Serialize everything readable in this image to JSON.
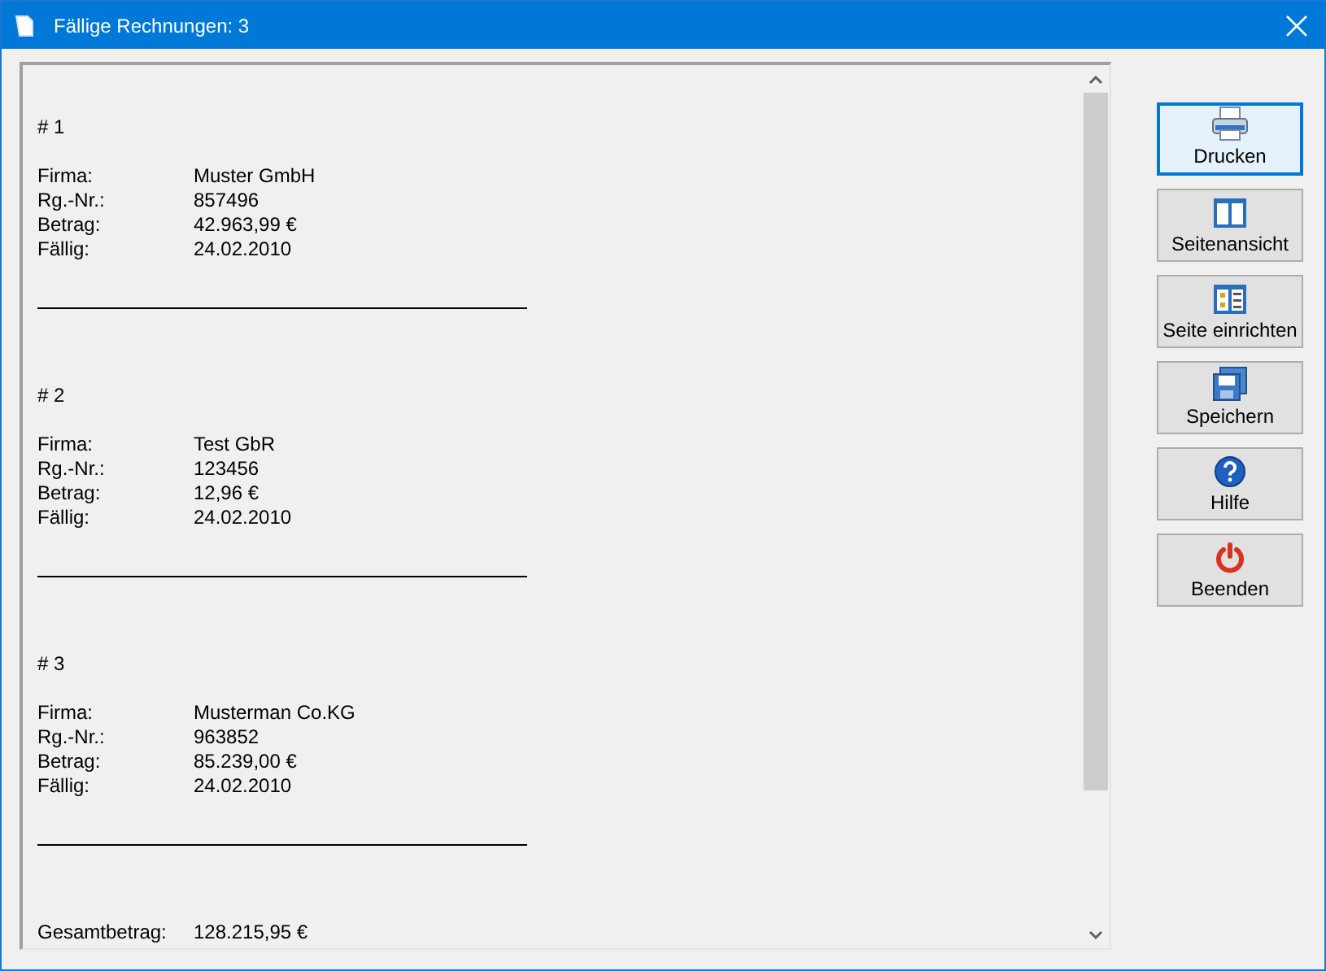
{
  "window": {
    "title": "Fällige Rechnungen: 3"
  },
  "invoices": [
    {
      "heading": "# 1",
      "fields": [
        {
          "label": "Firma:",
          "value": "Muster GmbH"
        },
        {
          "label": "Rg.-Nr.:",
          "value": "857496"
        },
        {
          "label": "Betrag:",
          "value": "42.963,99 €"
        },
        {
          "label": "Fällig:",
          "value": "24.02.2010"
        }
      ]
    },
    {
      "heading": "# 2",
      "fields": [
        {
          "label": "Firma:",
          "value": "Test GbR"
        },
        {
          "label": "Rg.-Nr.:",
          "value": "123456"
        },
        {
          "label": "Betrag:",
          "value": "12,96 €"
        },
        {
          "label": "Fällig:",
          "value": "24.02.2010"
        }
      ]
    },
    {
      "heading": "# 3",
      "fields": [
        {
          "label": "Firma:",
          "value": "Musterman Co.KG"
        },
        {
          "label": "Rg.-Nr.:",
          "value": "963852"
        },
        {
          "label": "Betrag:",
          "value": "85.239,00 €"
        },
        {
          "label": "Fällig:",
          "value": "24.02.2010"
        }
      ]
    }
  ],
  "total": {
    "label": "Gesamtbetrag:",
    "value": "128.215,95 €"
  },
  "buttons": [
    {
      "kind": "print",
      "label": "Drucken",
      "focused": true
    },
    {
      "kind": "preview",
      "label": "Seitenansicht",
      "focused": false
    },
    {
      "kind": "setup",
      "label": "Seite einrichten",
      "focused": false
    },
    {
      "kind": "save",
      "label": "Speichern",
      "focused": false
    },
    {
      "kind": "help",
      "label": "Hilfe",
      "focused": false
    },
    {
      "kind": "exit",
      "label": "Beenden",
      "focused": false
    }
  ]
}
